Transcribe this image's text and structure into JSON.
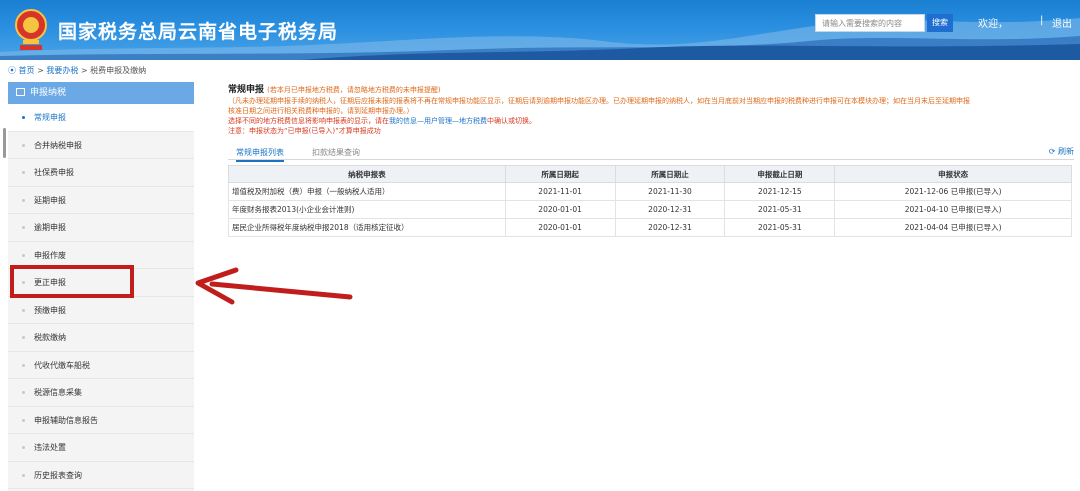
{
  "header": {
    "site_title": "国家税务总局云南省电子税务局",
    "search_placeholder": "请输入需要搜索的内容",
    "search_button": "搜索",
    "welcome": "欢迎，",
    "separator": "|",
    "logout": "退出",
    "colors": {
      "primary": "#1a7fd1",
      "accent": "#1f6fd0"
    }
  },
  "breadcrumb": {
    "icon": "location-pin-icon",
    "home": "首页",
    "sep1": ">",
    "level2": "我要办税",
    "sep2": ">",
    "current": "税费申报及缴纳"
  },
  "sidebar": {
    "header": "申报纳税",
    "items": [
      {
        "label": "常规申报"
      },
      {
        "label": "合并纳税申报"
      },
      {
        "label": "社保费申报"
      },
      {
        "label": "延期申报"
      },
      {
        "label": "逾期申报"
      },
      {
        "label": "申报作废"
      },
      {
        "label": "更正申报"
      },
      {
        "label": "预缴申报"
      },
      {
        "label": "税款缴纳"
      },
      {
        "label": "代收代缴车船税"
      },
      {
        "label": "税源信息采集"
      },
      {
        "label": "申报辅助信息报告"
      },
      {
        "label": "违法处置"
      },
      {
        "label": "历史报表查询"
      }
    ]
  },
  "main": {
    "title": "常规申报",
    "title_tip": "(若本月已申报地方税费，请忽略地方税费的未申报提醒)",
    "notice_line1": "（凡未办理延期申报手续的纳税人，征期后应报未报的报表将不再在常规申报功能区显示，征期后请到逾期申报功能区办理。已办理延期申报的纳税人，如在当月底前对当期应申报的税费种进行申报可在本模块办理；如在当月末后至延期申报",
    "notice_line2": "核准日期之间进行相关税费种申报的，请到延期申报办理。）",
    "notice_line3a": "选择不同的地方税费信息将影响申报表的显示，请在",
    "notice_line3b": "我的信息—用户管理—地方税费",
    "notice_line3c": "中确认或切换。",
    "notice_line4": "注意：申报状态为“已申报(已导入)”才算申报成功",
    "tabs": [
      {
        "label": "常规申报列表"
      },
      {
        "label": "扣款结果查询"
      }
    ],
    "refresh": "刷新"
  },
  "table": {
    "headers": [
      "纳税申报表",
      "所属日期起",
      "所属日期止",
      "申报截止日期",
      "申报状态"
    ],
    "rows": [
      [
        "增值税及附加税（费）申报（一般纳税人适用）",
        "2021-11-01",
        "2021-11-30",
        "2021-12-15",
        "2021-12-06 已申报(已导入)"
      ],
      [
        "年度财务报表2013(小企业会计准则)",
        "2020-01-01",
        "2020-12-31",
        "2021-05-31",
        "2021-04-10 已申报(已导入)"
      ],
      [
        "居民企业所得税年度纳税申报2018（适用核定征收）",
        "2020-01-01",
        "2020-12-31",
        "2021-05-31",
        "2021-04-04 已申报(已导入)"
      ]
    ]
  },
  "annotation": {
    "color": "#c21d1d"
  }
}
